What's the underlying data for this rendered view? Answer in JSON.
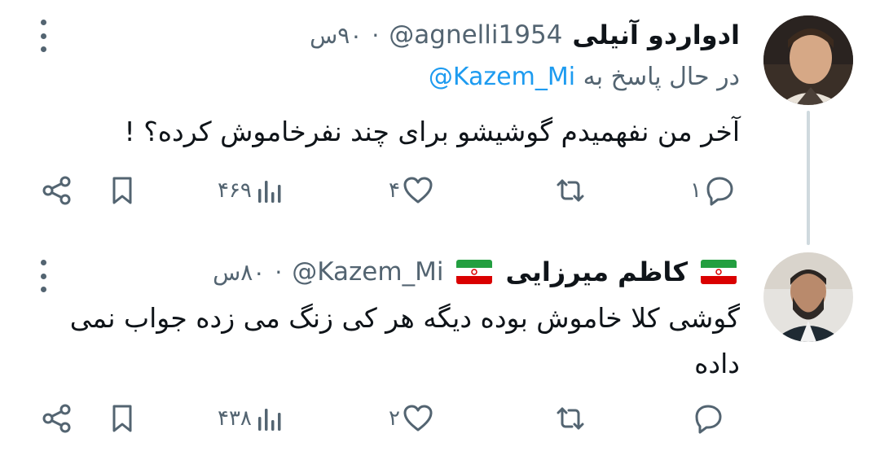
{
  "tweets": [
    {
      "name": "ادواردو آنیلی",
      "handle": "@agnelli1954",
      "dot": "·",
      "time": "۹۰س",
      "replying_prefix": "در حال پاسخ به",
      "replying_to": "@Kazem_Mi",
      "text": "آخر من نفهمیدم گوشیشو برای چند نفرخاموش کرده؟ !",
      "stats": {
        "replies": "۱",
        "retweets": "",
        "likes": "۴",
        "views": "۴۶۹"
      }
    },
    {
      "name": "کاظم میرزایی",
      "handle": "@Kazem_Mi",
      "dot": "·",
      "time": "۸۰س",
      "text": "گوشی کلا خاموش بوده دیگه هر کی زنگ می زده جواب نمی\nداده",
      "stats": {
        "replies": "",
        "retweets": "",
        "likes": "۲",
        "views": "۴۳۸"
      }
    }
  ],
  "icons": {
    "reply": "reply-icon",
    "retweet": "retweet-icon",
    "like": "heart-icon",
    "views": "views-icon",
    "bookmark": "bookmark-icon",
    "share": "share-icon",
    "more": "more-vertical-icon",
    "flag": "iran-flag-icon"
  },
  "colors": {
    "text": "#0f1419",
    "secondary": "#536471",
    "link": "#1d9bf0",
    "thread": "#cfd9de"
  }
}
